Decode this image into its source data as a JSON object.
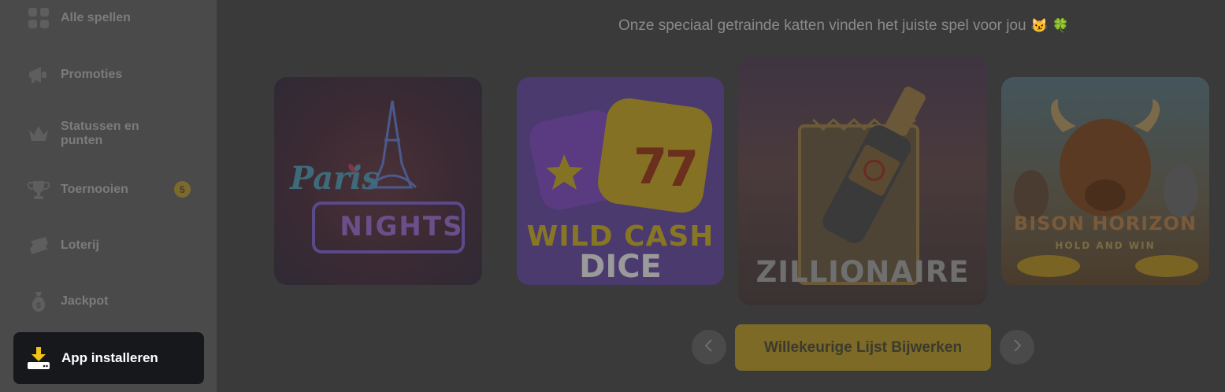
{
  "sidebar": {
    "items": [
      {
        "label": "Alle spellen",
        "icon": "grid-icon"
      },
      {
        "label": "Promoties",
        "icon": "megaphone-icon"
      },
      {
        "label": "Statussen en punten",
        "icon": "crown-icon"
      },
      {
        "label": "Toernooien",
        "icon": "trophy-icon",
        "badge": "5"
      },
      {
        "label": "Loterij",
        "icon": "lottery-ticket-icon"
      },
      {
        "label": "Jackpot",
        "icon": "money-bag-icon"
      }
    ],
    "install": {
      "label": "App installeren",
      "icon": "download-icon"
    }
  },
  "main": {
    "subtitle": "Onze speciaal getrainde katten vinden het juiste spel voor jou",
    "subtitle_emojis": [
      "😼",
      "🍀"
    ],
    "games": [
      {
        "title_line1": "Paris",
        "title_line2": "NIGHTS"
      },
      {
        "title_line1": "WILD CASH",
        "title_line2": "DICE"
      },
      {
        "title_line1": "ZILLIONAIRE"
      },
      {
        "title_line1": "BISON HORIZON",
        "title_line2": "HOLD AND WIN"
      }
    ],
    "refresh_label": "Willekeurige Lijst Bijwerken",
    "prev_icon": "chevron-left-icon",
    "next_icon": "chevron-right-icon"
  },
  "colors": {
    "overlay_bg": "#3a3a3a",
    "sidebar_bg": "#4a4a4a",
    "accent": "#7c6a26",
    "install_bg": "#17181c"
  }
}
